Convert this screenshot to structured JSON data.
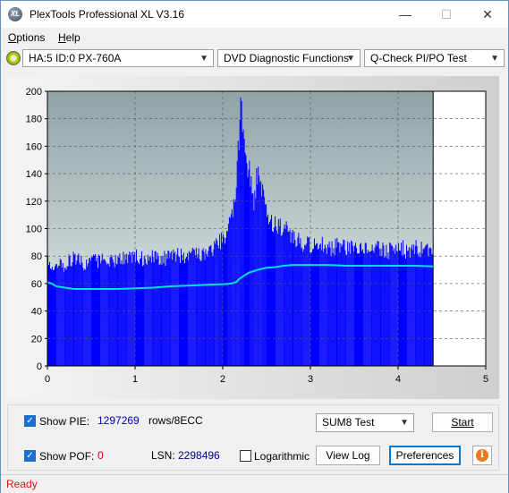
{
  "window": {
    "title": "PlexTools Professional XL V3.16",
    "icon_text": "XL",
    "minimize": "—",
    "maximize": "☐",
    "close": "✕"
  },
  "menu": {
    "items": [
      {
        "label": "Options",
        "underline": "O",
        "rest": "ptions"
      },
      {
        "label": "Help",
        "underline": "H",
        "rest": "elp"
      }
    ]
  },
  "toolbar": {
    "drive": "HA:5 ID:0  PX-760A",
    "function": "DVD Diagnostic Functions",
    "test": "Q-Check PI/PO Test"
  },
  "chart_data": {
    "type": "area",
    "xlim": [
      0,
      5
    ],
    "ylim": [
      0,
      200
    ],
    "x_ticks": [
      "0",
      "1",
      "2",
      "3",
      "4",
      "5"
    ],
    "y_ticks": [
      "0",
      "20",
      "40",
      "60",
      "80",
      "100",
      "120",
      "140",
      "160",
      "180",
      "200"
    ],
    "grid": true,
    "end_marker_x": 4.4,
    "colors": {
      "bars": "#0000ff",
      "line": "#00e0e0",
      "plot_bg_top": "#8fa3a5",
      "plot_bg_bottom": "#eef3f3",
      "after_end": "#ffffff"
    },
    "series": [
      {
        "kind": "bars",
        "x": [
          0.0,
          0.1,
          0.2,
          0.3,
          0.4,
          0.5,
          0.6,
          0.7,
          0.8,
          0.9,
          1.0,
          1.1,
          1.2,
          1.3,
          1.4,
          1.5,
          1.6,
          1.7,
          1.8,
          1.9,
          1.95,
          2.0,
          2.05,
          2.1,
          2.15,
          2.2,
          2.25,
          2.3,
          2.35,
          2.4,
          2.45,
          2.5,
          2.6,
          2.7,
          2.8,
          2.9,
          3.0,
          3.1,
          3.2,
          3.3,
          3.4,
          3.5,
          3.6,
          3.7,
          3.8,
          3.9,
          4.0,
          4.1,
          4.2,
          4.3,
          4.4
        ],
        "values": [
          82,
          78,
          80,
          84,
          80,
          82,
          82,
          84,
          82,
          84,
          86,
          84,
          86,
          84,
          86,
          86,
          84,
          88,
          86,
          92,
          96,
          100,
          104,
          116,
          145,
          198,
          175,
          150,
          130,
          155,
          140,
          120,
          110,
          108,
          102,
          96,
          94,
          96,
          92,
          94,
          92,
          92,
          92,
          94,
          92,
          90,
          94,
          90,
          92,
          92,
          88
        ]
      },
      {
        "kind": "line",
        "x": [
          0.0,
          0.05,
          0.1,
          0.2,
          0.3,
          0.4,
          0.5,
          0.6,
          0.8,
          1.0,
          1.2,
          1.4,
          1.6,
          1.8,
          2.0,
          2.1,
          2.15,
          2.2,
          2.3,
          2.4,
          2.5,
          2.6,
          2.7,
          2.8,
          3.0,
          3.2,
          3.4,
          3.6,
          3.8,
          4.0,
          4.2,
          4.4
        ],
        "values": [
          61,
          60,
          58,
          57,
          56,
          56,
          56,
          56,
          56,
          56.5,
          57,
          58,
          58.5,
          59,
          59.5,
          60,
          61,
          64,
          68,
          70,
          71.5,
          72,
          73,
          73.5,
          73.5,
          73.5,
          73,
          73,
          73,
          73,
          73,
          72.5
        ]
      }
    ]
  },
  "controls": {
    "show_pie_label": "Show PIE:",
    "show_pie_value": "1297269",
    "show_pie_unit": "rows/8ECC",
    "show_poe_label": "Show POF:",
    "show_poe_value": "0",
    "lsn_label": "LSN:",
    "lsn_value": "2298496",
    "logarithmic_label": "Logarithmic",
    "test_select": "SUM8 Test",
    "start": "Start",
    "view_log": "View Log",
    "preferences": "Preferences",
    "info_icon": "i"
  },
  "status": {
    "text": "Ready"
  }
}
